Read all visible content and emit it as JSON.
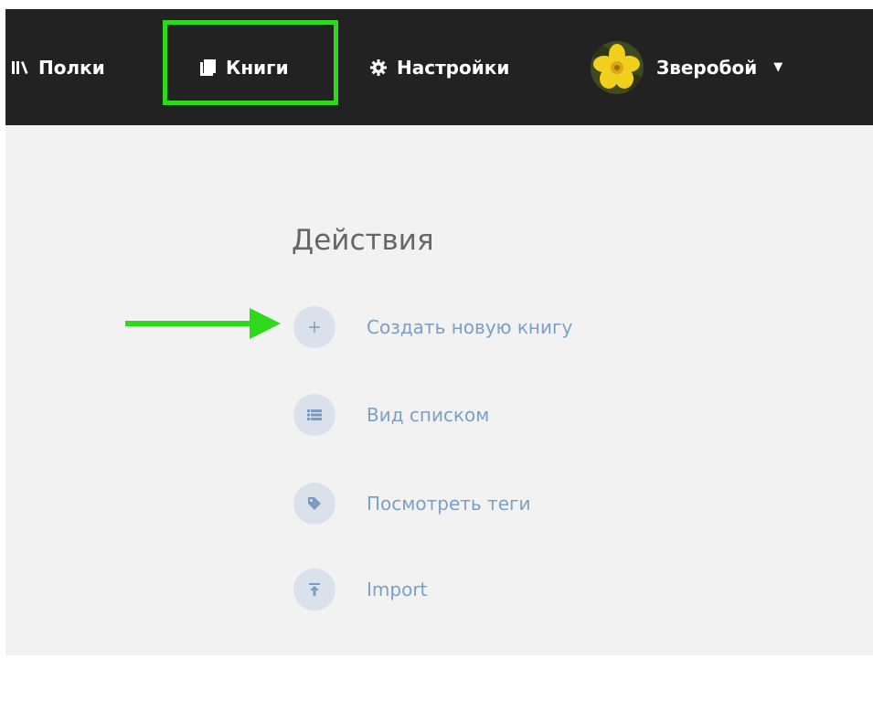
{
  "nav": {
    "shelves_label": "Полки",
    "books_label": "Книги",
    "settings_label": "Настройки",
    "user_name": "Зверобой"
  },
  "actions": {
    "title": "Действия",
    "items": [
      {
        "label": "Создать новую книгу",
        "icon": "plus-icon"
      },
      {
        "label": "Вид списком",
        "icon": "list-icon"
      },
      {
        "label": "Посмотреть теги",
        "icon": "tag-icon"
      },
      {
        "label": "Import",
        "icon": "upload-icon"
      }
    ]
  },
  "colors": {
    "topbar": "#222222",
    "highlight": "#2ed81a",
    "link": "#7ba0c4",
    "content_bg": "#f2f2f2"
  }
}
